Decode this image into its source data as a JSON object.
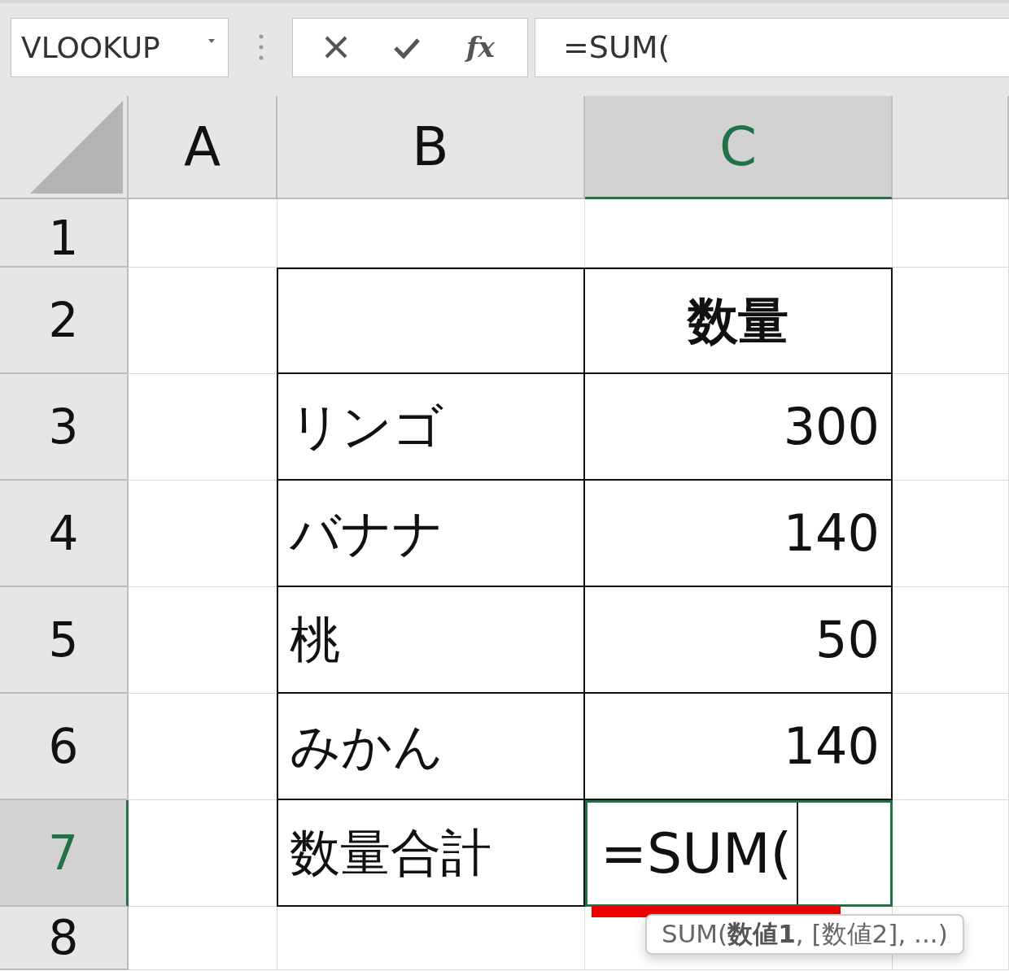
{
  "name_box": {
    "value": "VLOOKUP"
  },
  "formula_bar": {
    "function_button": "fx",
    "value": "=SUM("
  },
  "columns": [
    {
      "label": "A",
      "selected": false
    },
    {
      "label": "B",
      "selected": false
    },
    {
      "label": "C",
      "selected": true
    }
  ],
  "rows": [
    {
      "header": "1",
      "selected": false,
      "kind": "blank"
    },
    {
      "header": "2",
      "selected": false,
      "kind": "heading",
      "value": "数量"
    },
    {
      "header": "3",
      "selected": false,
      "kind": "item",
      "label": "リンゴ",
      "value": "300"
    },
    {
      "header": "4",
      "selected": false,
      "kind": "item",
      "label": "バナナ",
      "value": "140"
    },
    {
      "header": "5",
      "selected": false,
      "kind": "item",
      "label": "桃",
      "value": "50"
    },
    {
      "header": "6",
      "selected": false,
      "kind": "item",
      "label": "みかん",
      "value": "140"
    },
    {
      "header": "7",
      "selected": true,
      "kind": "editing",
      "label": "数量合計",
      "value": "=SUM("
    },
    {
      "header": "8",
      "selected": false,
      "kind": "blank"
    }
  ],
  "tooltip": "SUM(**数値1**, [数値2], ...)"
}
